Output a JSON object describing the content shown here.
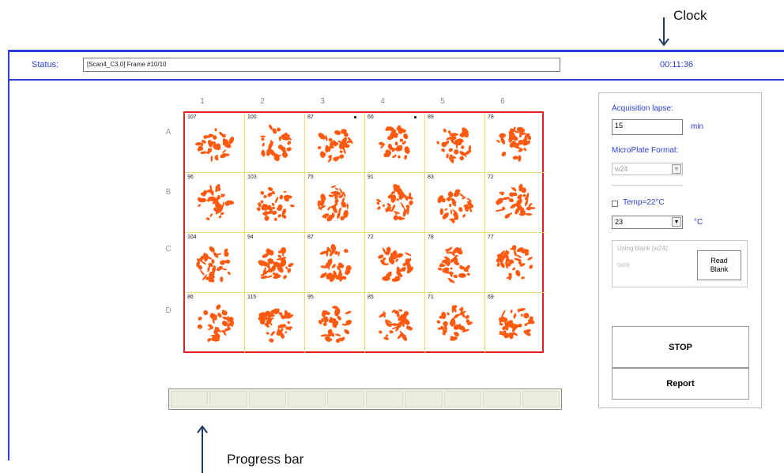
{
  "annotations": {
    "clock_label": "Clock",
    "progress_label": "Progress bar"
  },
  "status": {
    "label": "Status:",
    "value": "[Scan4_C3.0] Frame #10/10",
    "clock": "00:11:36"
  },
  "plate": {
    "columns": [
      "1",
      "2",
      "3",
      "4",
      "5",
      "6"
    ],
    "rows": [
      "A",
      "B",
      "C",
      "D"
    ],
    "well_counts": [
      [
        "107",
        "100",
        "87",
        "66",
        "89",
        "78"
      ],
      [
        "96",
        "103",
        "75",
        "91",
        "83",
        "72"
      ],
      [
        "104",
        "94",
        "87",
        "72",
        "78",
        "77"
      ],
      [
        "86",
        "115",
        "95",
        "85",
        "71",
        "69"
      ]
    ],
    "colony_color": "#ff5a10",
    "border_color": "#e02020",
    "grid_color": "#e6e07a"
  },
  "progress": {
    "segments": 10
  },
  "panel": {
    "acq_label": "Acquisition lapse:",
    "acq_value": "15",
    "acq_unit": "min",
    "format_label": "MicroPlate Format:",
    "format_value": "w24",
    "temp_label": "Temp=22°C",
    "temp_value": "23",
    "temp_unit": "°C",
    "blank_title": "Using blank [w24]:",
    "blank_id": "0808",
    "read_blank": "Read\nBlank",
    "stop": "STOP",
    "report": "Report"
  },
  "colors": {
    "accent": "#2a3fd6"
  }
}
